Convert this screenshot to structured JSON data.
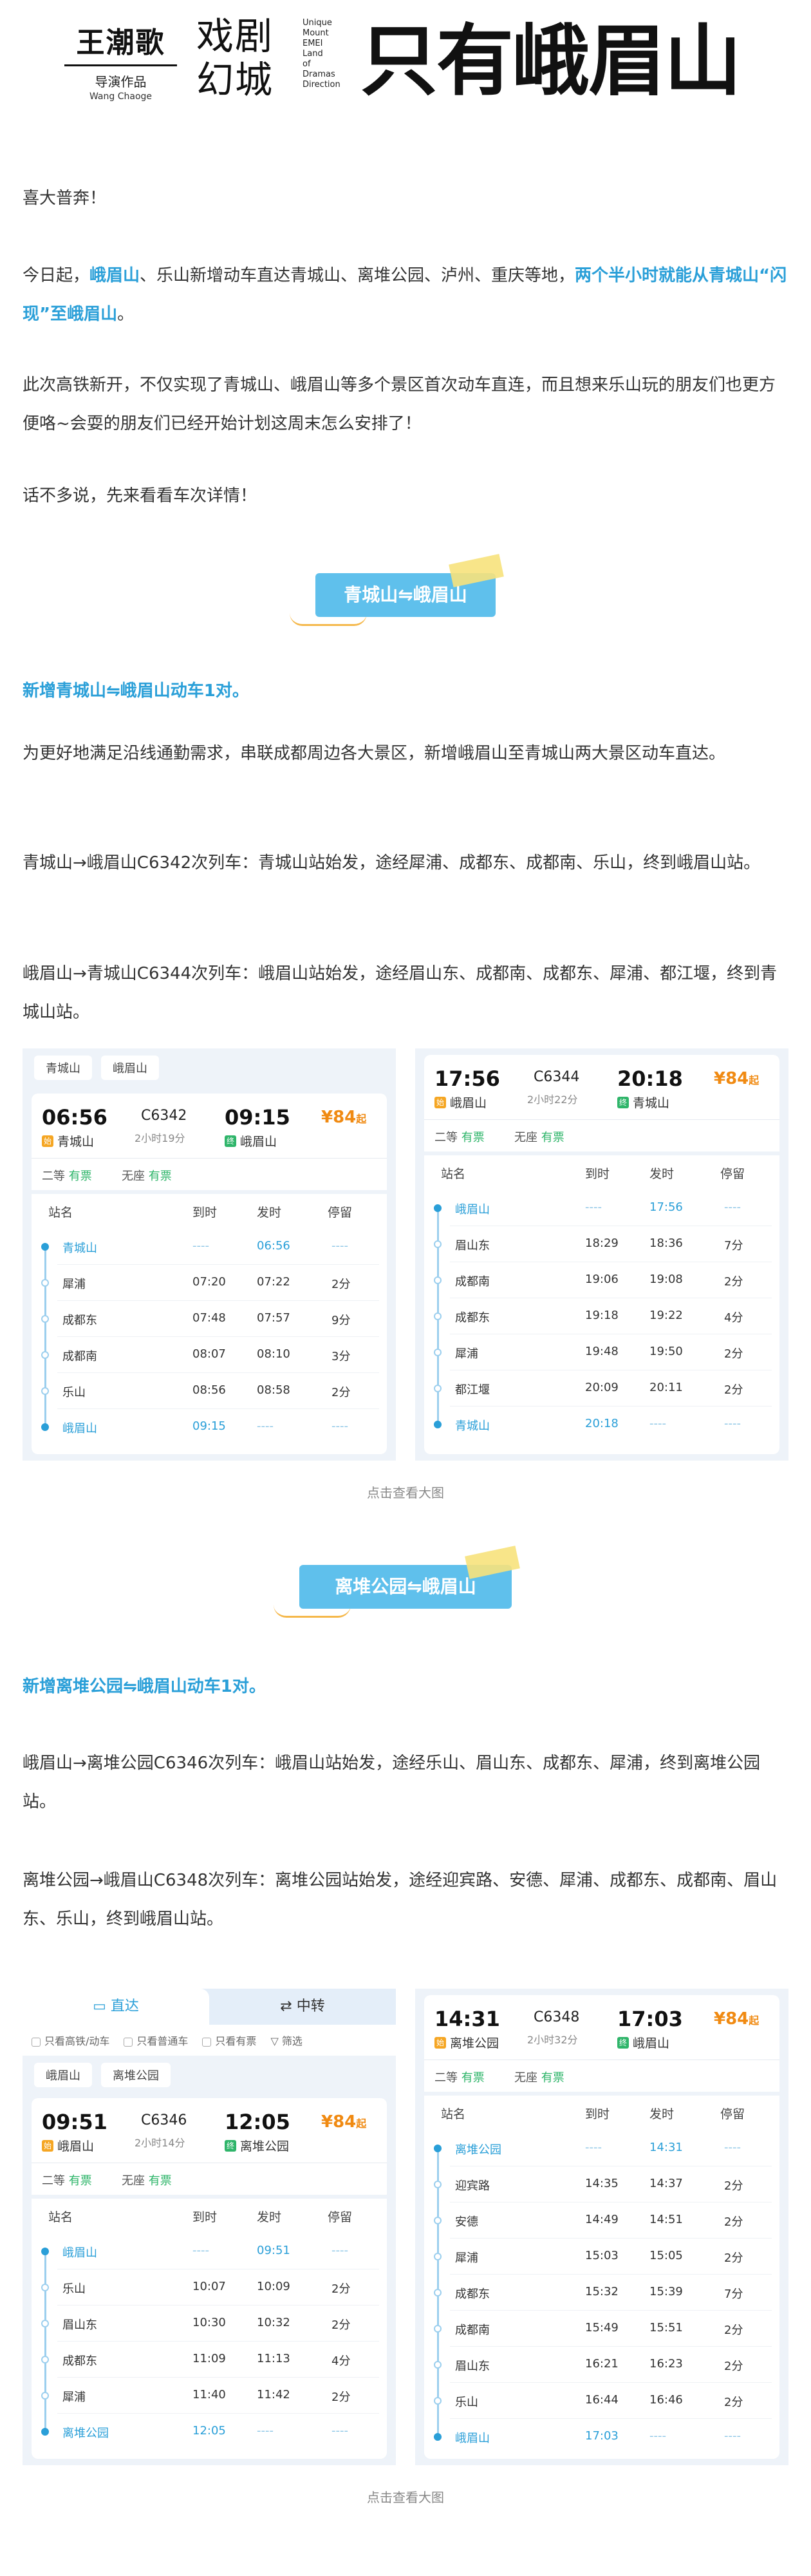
{
  "header": {
    "brand_cn": "王潮歌",
    "brand_sub": "导演作品",
    "brand_en": "Wang Chaoge",
    "show_name_line1": "戏剧",
    "show_name_line2": "幻城",
    "stack_en": [
      "Unique",
      "Mount",
      "EMEI",
      "Land",
      "of",
      "Dramas",
      "Direction"
    ],
    "title": "只有峨眉山"
  },
  "intro": {
    "greeting": "喜大普奔！",
    "p1_a": "今日起，",
    "p1_hl1": "峨眉山",
    "p1_b": "、乐山新增动车直达青城山、离堆公园、泸州、重庆等地，",
    "p1_hl2": "两个半小时就能从青城山“闪现”至峨眉山",
    "p1_c": "。",
    "p2": "此次高铁新开，不仅实现了青城山、峨眉山等多个景区首次动车直连，而且想来乐山玩的朋友们也更方便咯~会耍的朋友们已经开始计划这周末怎么安排了！",
    "p3": "话不多说，先来看看车次详情！"
  },
  "section1": {
    "banner": "青城山⇋峨眉山",
    "heading": "新增青城山⇋峨眉山动车1对。",
    "p1": "为更好地满足沿线通勤需求，串联成都周边各大景区，新增峨眉山至青城山两大景区动车直达。",
    "p2": "青城山→峨眉山C6342次列车：青城山站始发，途经犀浦、成都东、成都南、乐山，终到峨眉山站。",
    "p3": "峨眉山→青城山C6344次列车：峨眉山站始发，途经眉山东、成都南、成都东、犀浦、都江堰，终到青城山站。",
    "caption": "点击查看大图"
  },
  "section2": {
    "banner": "离堆公园⇋峨眉山",
    "heading": "新增离堆公园⇋峨眉山动车1对。",
    "p1": "峨眉山→离堆公园C6346次列车：峨眉山站始发，途经乐山、眉山东、成都东、犀浦，终到离堆公园站。",
    "p2": "离堆公园→峨眉山C6348次列车：离堆公园站始发，途经迎宾路、安德、犀浦、成都东、成都南、眉山东、乐山，终到峨眉山站。",
    "caption": "点击查看大图"
  },
  "table_labels": {
    "station": "站名",
    "arrive": "到时",
    "depart": "发时",
    "stop": "停留",
    "second": "二等",
    "noseat": "无座",
    "available": "有票",
    "start_tag": "始",
    "end_tag": "终",
    "price_suffix": "起"
  },
  "trains": [
    {
      "chips": [
        "青城山",
        "峨眉山"
      ],
      "dep_time": "06:56",
      "number": "C6342",
      "duration": "2小时19分",
      "arr_time": "09:15",
      "from": "青城山",
      "to": "峨眉山",
      "price": "¥84",
      "stops": [
        [
          "青城山",
          "----",
          "06:56",
          "----"
        ],
        [
          "犀浦",
          "07:20",
          "07:22",
          "2分"
        ],
        [
          "成都东",
          "07:48",
          "07:57",
          "9分"
        ],
        [
          "成都南",
          "08:07",
          "08:10",
          "3分"
        ],
        [
          "乐山",
          "08:56",
          "08:58",
          "2分"
        ],
        [
          "峨眉山",
          "09:15",
          "----",
          "----"
        ]
      ]
    },
    {
      "dep_time": "17:56",
      "number": "C6344",
      "duration": "2小时22分",
      "arr_time": "20:18",
      "from": "峨眉山",
      "to": "青城山",
      "price": "¥84",
      "stops": [
        [
          "峨眉山",
          "----",
          "17:56",
          "----"
        ],
        [
          "眉山东",
          "18:29",
          "18:36",
          "7分"
        ],
        [
          "成都南",
          "19:06",
          "19:08",
          "2分"
        ],
        [
          "成都东",
          "19:18",
          "19:22",
          "4分"
        ],
        [
          "犀浦",
          "19:48",
          "19:50",
          "2分"
        ],
        [
          "都江堰",
          "20:09",
          "20:11",
          "2分"
        ],
        [
          "青城山",
          "20:18",
          "----",
          "----"
        ]
      ]
    },
    {
      "tabs": [
        "直达",
        "中转"
      ],
      "filters": [
        "只看高铁/动车",
        "只看普通车",
        "只看有票",
        "筛选"
      ],
      "chips": [
        "峨眉山",
        "离堆公园"
      ],
      "dep_time": "09:51",
      "number": "C6346",
      "duration": "2小时14分",
      "arr_time": "12:05",
      "from": "峨眉山",
      "to": "离堆公园",
      "price": "¥84",
      "stops": [
        [
          "峨眉山",
          "----",
          "09:51",
          "----"
        ],
        [
          "乐山",
          "10:07",
          "10:09",
          "2分"
        ],
        [
          "眉山东",
          "10:30",
          "10:32",
          "2分"
        ],
        [
          "成都东",
          "11:09",
          "11:13",
          "4分"
        ],
        [
          "犀浦",
          "11:40",
          "11:42",
          "2分"
        ],
        [
          "离堆公园",
          "12:05",
          "----",
          "----"
        ]
      ]
    },
    {
      "dep_time": "14:31",
      "number": "C6348",
      "duration": "2小时32分",
      "arr_time": "17:03",
      "from": "离堆公园",
      "to": "峨眉山",
      "price": "¥84",
      "stops": [
        [
          "离堆公园",
          "----",
          "14:31",
          "----"
        ],
        [
          "迎宾路",
          "14:35",
          "14:37",
          "2分"
        ],
        [
          "安德",
          "14:49",
          "14:51",
          "2分"
        ],
        [
          "犀浦",
          "15:03",
          "15:05",
          "2分"
        ],
        [
          "成都东",
          "15:32",
          "15:39",
          "7分"
        ],
        [
          "成都南",
          "15:49",
          "15:51",
          "2分"
        ],
        [
          "眉山东",
          "16:21",
          "16:23",
          "2分"
        ],
        [
          "乐山",
          "16:44",
          "16:46",
          "2分"
        ],
        [
          "峨眉山",
          "17:03",
          "----",
          "----"
        ]
      ]
    }
  ]
}
